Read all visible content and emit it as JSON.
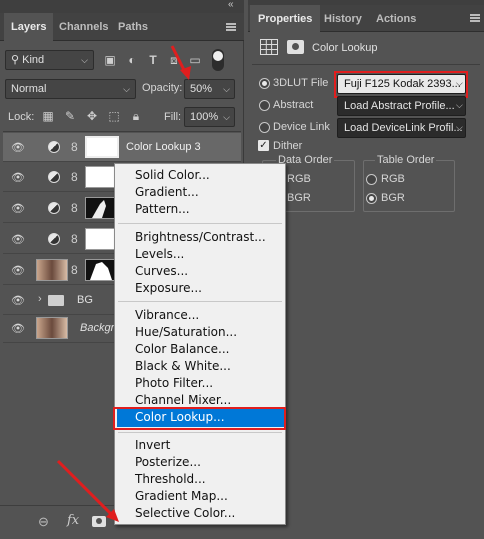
{
  "left_panel": {
    "tabs": [
      "Layers",
      "Channels",
      "Paths"
    ],
    "filter_label": "Kind",
    "blend_mode": "Normal",
    "opacity_label": "Opacity:",
    "opacity_value": "50%",
    "lock_label": "Lock:",
    "fill_label": "Fill:",
    "fill_value": "100%",
    "layers": [
      {
        "name": "Color Lookup 3",
        "type": "adjustment"
      },
      {
        "name": "",
        "type": "adjustment"
      },
      {
        "name": "",
        "type": "adjustment-mask"
      },
      {
        "name": "",
        "type": "adjustment"
      },
      {
        "name": "",
        "type": "image-mask"
      },
      {
        "name": "BG",
        "type": "group"
      },
      {
        "name": "Backgro",
        "type": "image"
      }
    ]
  },
  "right_panel": {
    "tabs": [
      "Properties",
      "History",
      "Actions"
    ],
    "header_title": "Color Lookup",
    "options": [
      {
        "label": "3DLUT File",
        "value": "Fuji F125 Kodak 2393...",
        "selected": true
      },
      {
        "label": "Abstract",
        "value": "Load Abstract Profile...",
        "selected": false
      },
      {
        "label": "Device Link",
        "value": "Load DeviceLink Profil...",
        "selected": false
      }
    ],
    "dither_label": "Dither",
    "dither_checked": true,
    "data_order_title": "Data Order",
    "data_order_options": [
      "RGB",
      "BGR"
    ],
    "table_order_title": "Table Order",
    "table_order_options": [
      "RGB",
      "BGR"
    ],
    "table_order_selected": "BGR"
  },
  "context_menu": {
    "groups": [
      [
        "Solid Color...",
        "Gradient...",
        "Pattern..."
      ],
      [
        "Brightness/Contrast...",
        "Levels...",
        "Curves...",
        "Exposure..."
      ],
      [
        "Vibrance...",
        "Hue/Saturation...",
        "Color Balance...",
        "Black & White...",
        "Photo Filter...",
        "Channel Mixer...",
        "Color Lookup..."
      ],
      [
        "Invert",
        "Posterize...",
        "Threshold...",
        "Gradient Map...",
        "Selective Color..."
      ]
    ],
    "highlighted": "Color Lookup..."
  },
  "colors": {
    "panel_bg": "#535353",
    "highlight": "#0078d7",
    "annotation_red": "#e01e1e"
  }
}
